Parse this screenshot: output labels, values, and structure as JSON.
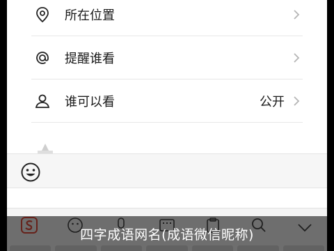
{
  "menu": {
    "items": [
      {
        "label": "所在位置",
        "value": "",
        "icon": "location-pin-icon"
      },
      {
        "label": "提醒谁看",
        "value": "",
        "icon": "at-sign-icon"
      },
      {
        "label": "谁可以看",
        "value": "公开",
        "icon": "person-icon"
      }
    ]
  },
  "toolbar": {
    "icons": [
      "sogou-logo-icon",
      "emoji-icon",
      "microphone-icon",
      "keyboard-icon",
      "clipboard-icon",
      "search-icon",
      "collapse-keyboard-icon"
    ]
  },
  "overlay": {
    "caption": "四字成语网名(成语微信昵称)"
  },
  "colors": {
    "page_bg": "#ffffff",
    "outer_bg": "#000000",
    "divider": "#e7e7e7",
    "text": "#1a1a1a",
    "chevron": "#b5b5b5",
    "sogou_red": "#e24a3a"
  }
}
